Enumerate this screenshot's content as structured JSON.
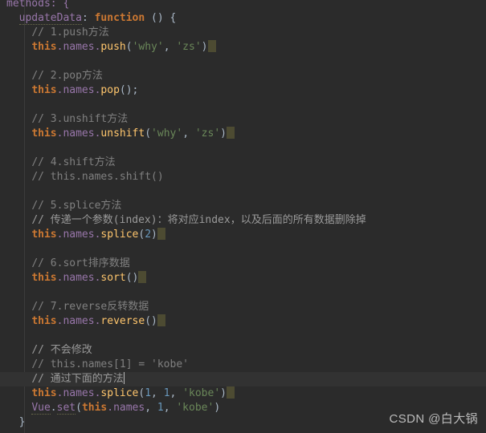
{
  "editor": {
    "theme": "darcula",
    "background": "#2b2b2b",
    "active_line_background": "#323232",
    "colors": {
      "keyword": "#cc7832",
      "property": "#9876aa",
      "function": "#ffc66d",
      "string": "#6a8759",
      "number": "#6897bb",
      "comment": "#808080",
      "default_text": "#a9b7c6",
      "marker": "#4d4b32",
      "caret": "#bbbbbb"
    }
  },
  "code": {
    "l01_methods": "methods: {",
    "l02_decl": "updateData",
    "l02_colon": ": ",
    "l02_function": "function",
    "l02_tail": " () {",
    "l03_c_push": "// 1.push方法",
    "l04_this": "this",
    "l04_dot_names": ".names.",
    "l04_push": "push",
    "l04_open": "(",
    "l04_s1": "'why'",
    "l04_comma": ", ",
    "l04_s2": "'zs'",
    "l04_close": ")",
    "l06_c_pop": "// 2.pop方法",
    "l07_pop": "pop",
    "l07_tail": "();",
    "l09_c_unshift": "// 3.unshift方法",
    "l10_unshift": "unshift",
    "l12_c_shift": "// 4.shift方法",
    "l13_c_shift_code": "// this.names.shift()",
    "l15_c_splice": "// 5.splice方法",
    "l16_c_splice_desc": "// 传递一个参数(index)：将对应index，以及后面的所有数据删除掉",
    "l17_splice": "splice",
    "l17_open": "(",
    "l17_num": "2",
    "l17_close": ")",
    "l19_c_sort": "// 6.sort排序数据",
    "l20_sort": "sort",
    "l20_tail": "()",
    "l22_c_reverse": "// 7.reverse反转数据",
    "l23_reverse": "reverse",
    "l23_tail": "()",
    "l25_c_nochange": "// 不会修改",
    "l26_c_assign": "// this.names[1] = 'kobe'",
    "l27_c_method": "// 通过下面的方法",
    "l28_splice": "splice",
    "l28_open": "(",
    "l28_n1": "1",
    "l28_c1": ", ",
    "l28_n2": "1",
    "l28_c2": ", ",
    "l28_str": "'kobe'",
    "l28_close": ")",
    "l29_vue": "Vue",
    "l29_dot": ".",
    "l29_set": "set",
    "l29_open": "(",
    "l29_this": "this",
    "l29_names": ".names",
    "l29_c1": ", ",
    "l29_n": "1",
    "l29_c2": ", ",
    "l29_str": "'kobe'",
    "l29_close": ")",
    "l30_brace": "}"
  },
  "watermark": {
    "text": "CSDN @白大锅"
  }
}
